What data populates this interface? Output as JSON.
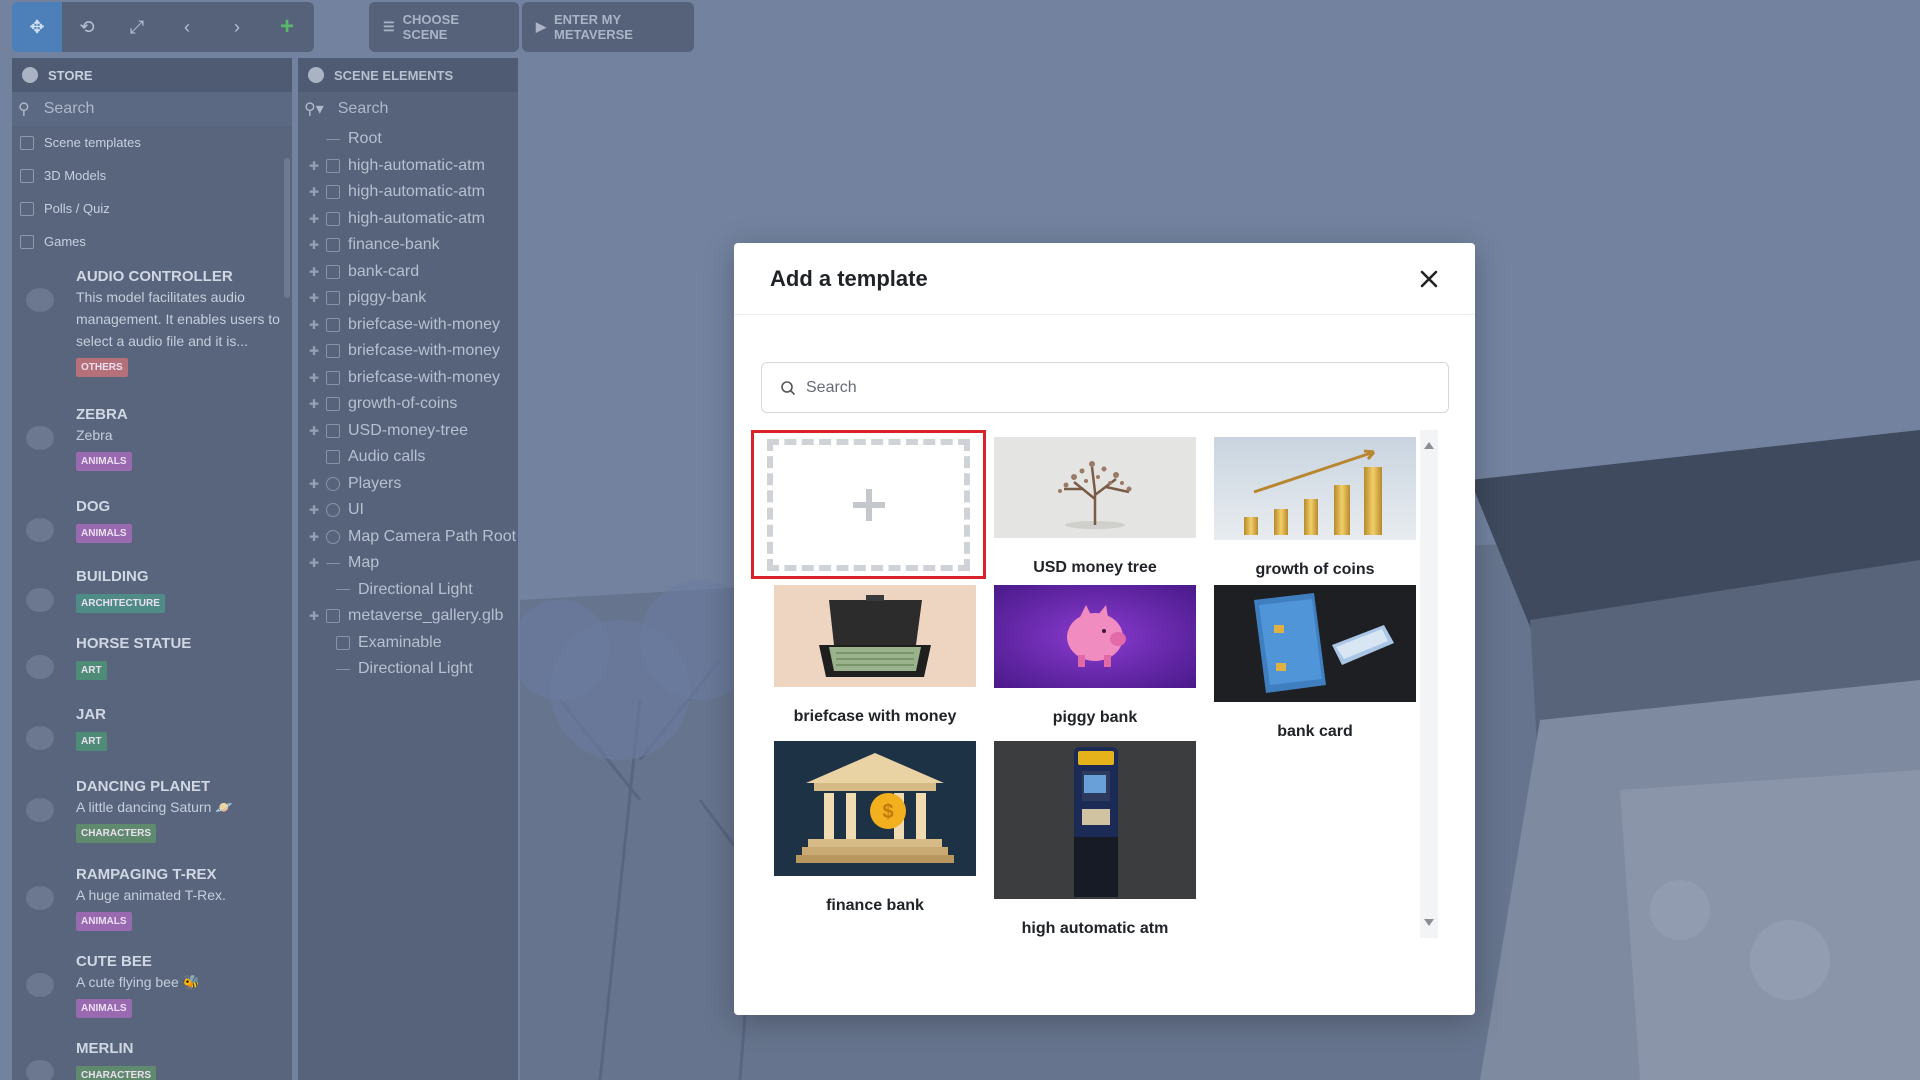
{
  "toolbar": {
    "tools": [
      "move-icon",
      "rotate-icon",
      "scale-icon",
      "undo-icon",
      "redo-icon",
      "add-icon"
    ],
    "choose_scene_label": "CHOOSE SCENE",
    "enter_metaverse_label": "ENTER MY METAVERSE"
  },
  "store": {
    "title": "STORE",
    "search_placeholder": "Search",
    "filters": [
      "Scene templates",
      "3D Models",
      "Polls / Quiz",
      "Games"
    ],
    "items": [
      {
        "title": "AUDIO CONTROLLER",
        "desc": "This model facilitates audio management. It enables users to select a audio file and it is...",
        "tag": "OTHERS",
        "tag_color": "#b5707a"
      },
      {
        "title": "ZEBRA",
        "desc": "Zebra",
        "tag": "ANIMALS",
        "tag_color": "#9a6ab0"
      },
      {
        "title": "DOG",
        "desc": "",
        "tag": "ANIMALS",
        "tag_color": "#9a6ab0"
      },
      {
        "title": "BUILDING",
        "desc": "",
        "tag": "ARCHITECTURE",
        "tag_color": "#4f8c88"
      },
      {
        "title": "HORSE STATUE",
        "desc": "",
        "tag": "ART",
        "tag_color": "#4f8c78"
      },
      {
        "title": "JAR",
        "desc": "",
        "tag": "ART",
        "tag_color": "#4f8c78"
      },
      {
        "title": "DANCING PLANET",
        "desc": "A little dancing Saturn 🪐",
        "tag": "CHARACTERS",
        "tag_color": "#5f8a6e"
      },
      {
        "title": "RAMPAGING T-REX",
        "desc": "A huge animated T-Rex.",
        "tag": "ANIMALS",
        "tag_color": "#9a6ab0"
      },
      {
        "title": "CUTE BEE",
        "desc": "A cute flying bee 🐝",
        "tag": "ANIMALS",
        "tag_color": "#9a6ab0"
      },
      {
        "title": "MERLIN",
        "desc": "",
        "tag": "CHARACTERS",
        "tag_color": "#5f8a6e"
      }
    ]
  },
  "scene_elements": {
    "title": "SCENE ELEMENTS",
    "search_placeholder": "Search",
    "tree": [
      {
        "label": "Root",
        "icon": "line",
        "expand": "none"
      },
      {
        "label": "high-automatic-atm",
        "icon": "box",
        "expand": "plus"
      },
      {
        "label": "high-automatic-atm",
        "icon": "box",
        "expand": "plus"
      },
      {
        "label": "high-automatic-atm",
        "icon": "box",
        "expand": "plus"
      },
      {
        "label": "finance-bank",
        "icon": "box",
        "expand": "plus"
      },
      {
        "label": "bank-card",
        "icon": "box",
        "expand": "plus"
      },
      {
        "label": "piggy-bank",
        "icon": "box",
        "expand": "plus"
      },
      {
        "label": "briefcase-with-money",
        "icon": "box",
        "expand": "plus"
      },
      {
        "label": "briefcase-with-money",
        "icon": "box",
        "expand": "plus"
      },
      {
        "label": "briefcase-with-money",
        "icon": "box",
        "expand": "plus"
      },
      {
        "label": "growth-of-coins",
        "icon": "box",
        "expand": "plus"
      },
      {
        "label": "USD-money-tree",
        "icon": "box",
        "expand": "plus"
      },
      {
        "label": "Audio calls",
        "icon": "box",
        "expand": "none"
      },
      {
        "label": "Players",
        "icon": "round",
        "expand": "plus"
      },
      {
        "label": "UI",
        "icon": "round",
        "expand": "plus"
      },
      {
        "label": "Map Camera Path Root",
        "icon": "round",
        "expand": "plus"
      },
      {
        "label": "Map",
        "icon": "line",
        "expand": "plus"
      },
      {
        "label": "Directional Light",
        "icon": "dot",
        "expand": "none"
      },
      {
        "label": "metaverse_gallery.glb",
        "icon": "box",
        "expand": "plus"
      },
      {
        "label": "Examinable",
        "icon": "box",
        "expand": "none"
      },
      {
        "label": "Directional Light",
        "icon": "dot",
        "expand": "none"
      }
    ]
  },
  "modal": {
    "title": "Add a template",
    "search_placeholder": "Search",
    "templates": [
      {
        "label": "USD money tree",
        "image": "money-tree-image"
      },
      {
        "label": "growth of coins",
        "image": "coins-growth-image"
      },
      {
        "label": "briefcase with money",
        "image": "briefcase-image"
      },
      {
        "label": "piggy bank",
        "image": "piggy-bank-image"
      },
      {
        "label": "bank card",
        "image": "bank-card-image"
      },
      {
        "label": "finance bank",
        "image": "finance-bank-image"
      },
      {
        "label": "high automatic atm",
        "image": "atm-image"
      }
    ]
  },
  "colors": {
    "overlay": "#6f7f9c",
    "selection_red": "#d9222a",
    "modal_bg": "#ffffff"
  }
}
